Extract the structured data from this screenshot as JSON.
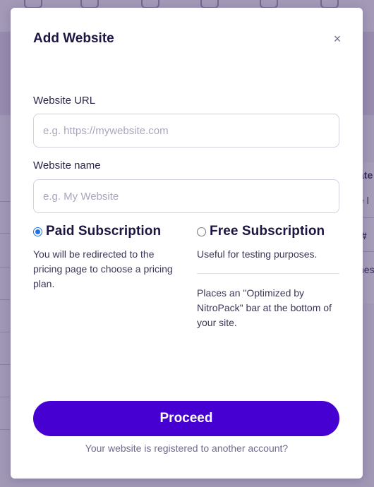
{
  "background": {
    "top_icons": [
      "chart-icon",
      "toggle-icon",
      "list-icon",
      "gauge-icon",
      "server-icon",
      "lock-icon"
    ],
    "right_fragments": [
      "ate",
      "e l",
      "/#",
      "nes"
    ]
  },
  "modal": {
    "title": "Add Website",
    "close_symbol": "×",
    "url_field": {
      "label": "Website URL",
      "value": "",
      "placeholder": "e.g. https://mywebsite.com"
    },
    "name_field": {
      "label": "Website name",
      "value": "",
      "placeholder": "e.g. My Website"
    },
    "subscription": {
      "selected": "paid",
      "paid": {
        "title": "Paid Subscription",
        "description": "You will be redirected to the pricing page to choose a pricing plan."
      },
      "free": {
        "title": "Free Subscription",
        "description": "Useful for testing purposes.",
        "note": "Places an \"Optimized by NitroPack\" bar at the bottom of your site."
      }
    },
    "proceed_label": "Proceed",
    "footer_link": "Your website is registered to another account?"
  },
  "colors": {
    "primary": "#4600d1",
    "title_text": "#1b1641",
    "radio_checked": "#1a73e8"
  }
}
